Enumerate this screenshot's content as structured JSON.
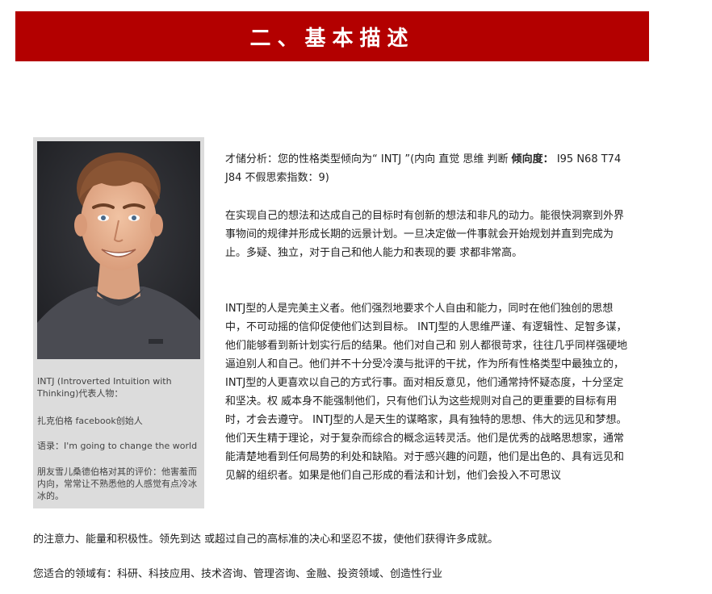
{
  "banner": {
    "title": "二、基本描述"
  },
  "profile": {
    "caption": "INTJ (Introverted Intuition with Thinking)代表人物：",
    "name_line": "扎克伯格 facebook创始人",
    "quote_line": "语录：I'm going to change the world",
    "comment_line": "朋友雪儿桑德伯格对其的评价：他害羞而内向，常常让不熟悉他的人感觉有点冷冰冰的。",
    "photo_icon": "person-portrait"
  },
  "analysis": {
    "prefix": "才储分析：您的性格类型倾向为“ INTJ ”(内向 直觉 思维 判断 ",
    "tendency_label": "倾向度：",
    "tendency_values": " I95 N68 T74 J84  不假思索指数：9)"
  },
  "paragraphs": {
    "intro": "在实现自己的想法和达成自己的目标时有创新的想法和非凡的动力。能很快洞察到外界事物间的规律并形成长期的远景计划。一旦决定做一件事就会开始规划并直到完成为止。多疑、独立，对于自己和他人能力和表现的要 求都非常高。",
    "body_main": "INTJ型的人是完美主义者。他们强烈地要求个人自由和能力，同时在他们独创的思想中，不可动摇的信仰促使他们达到目标。 INTJ型的人思维严谨、有逻辑性、足智多谋，他们能够看到新计划实行后的结果。他们对自己和 别人都很苛求，往往几乎同样强硬地逼迫别人和自己。他们并不十分受冷漠与批评的干扰，作为所有性格类型中最独立的，INTJ型的人更喜欢以自己的方式行事。面对相反意见，他们通常持怀疑态度，十分坚定和坚决。权 威本身不能强制他们，只有他们认为这些规则对自己的更重要的目标有用时，才会去遵守。 INTJ型的人是天生的谋略家，具有独特的思想、伟大的远见和梦想。他们天生精于理论，对于复杂而综合的概念运转灵活。他们是优秀的战略思想家，通常能清楚地看到任何局势的利处和缺陷。对于感兴趣的问题，他们是出色的、具有远见和见解的组织者。如果是他们自己形成的看法和计划，他们会投入不可思议",
    "body_tail": "的注意力、能量和积极性。领先到达 或超过自己的高标准的决心和坚忍不拔，使他们获得许多成就。",
    "fields": "您适合的领域有：科研、科技应用、技术咨询、管理咨询、金融、投资领域、创造性行业"
  },
  "colors": {
    "banner_bg": "#b30000",
    "banner_text": "#ffffff",
    "card_bg": "#dcdcdc"
  }
}
